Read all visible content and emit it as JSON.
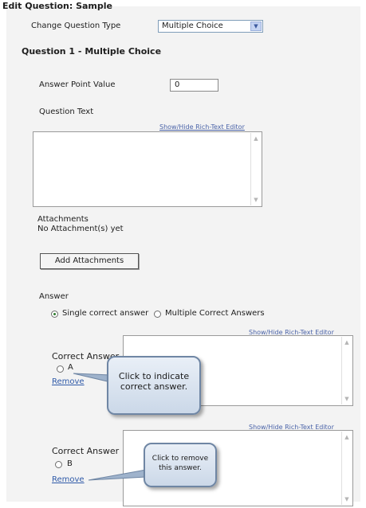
{
  "header": {
    "title": "Edit Question: Sample"
  },
  "question_type": {
    "label": "Change Question Type",
    "selected": "Multiple Choice"
  },
  "section_title": "Question 1 - Multiple Choice",
  "point_value": {
    "label": "Answer Point Value",
    "value": "0"
  },
  "question_text": {
    "label": "Question Text",
    "rich_text_link": "Show/Hide Rich-Text Editor"
  },
  "attachments": {
    "label": "Attachments",
    "status": "No Attachment(s) yet",
    "add_button": "Add Attachments"
  },
  "answer": {
    "label": "Answer",
    "mode_options": [
      {
        "label": "Single correct answer",
        "selected": true
      },
      {
        "label": "Multiple Correct Answers",
        "selected": false
      }
    ],
    "items": [
      {
        "correct_label": "Correct Answer",
        "letter": "A",
        "remove": "Remove",
        "rich_text_link": "Show/Hide Rich-Text Editor"
      },
      {
        "correct_label": "Correct Answer",
        "letter": "B",
        "remove": "Remove",
        "rich_text_link": "Show/Hide Rich-Text Editor"
      }
    ]
  },
  "callouts": {
    "indicate": "Click to indicate correct answer.",
    "remove": "Click to remove this answer."
  },
  "icons": {
    "select_arrow": "chevron-down-icon",
    "scroll_up": "scroll-up-arrow-icon",
    "scroll_down": "scroll-down-arrow-icon"
  }
}
